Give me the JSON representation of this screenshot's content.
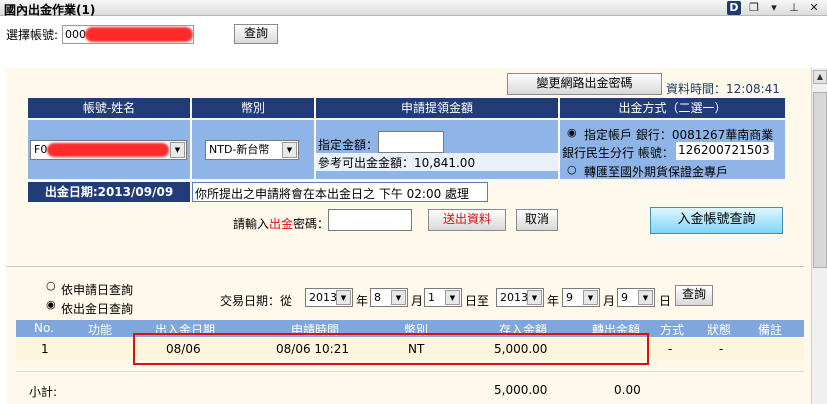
{
  "window": {
    "title": "國內出金作業(1)"
  },
  "account_select": {
    "label": "選擇帳號:",
    "value_prefix": "000",
    "query_button": "查詢"
  },
  "top_actions": {
    "change_password_button": "變更網路出金密碼",
    "data_time_label": "資料時間：12:08:41"
  },
  "headers": {
    "account_name": "帳號-姓名",
    "currency": "幣別",
    "withdraw_amount": "申請提領金額",
    "method": "出金方式（二選一）"
  },
  "account_dropdown": {
    "value_prefix": "F0"
  },
  "currency_dropdown": {
    "value": "NTD-新台幣"
  },
  "amount": {
    "label": "指定金額：",
    "reference_label": "參考可出金金額：10,841.00"
  },
  "method": {
    "option1_line1": "指定帳戶 銀行：0081267華南商業",
    "option1_line2": "銀行民生分行  帳號：",
    "option1_account": "126200721503",
    "option2": "轉匯至國外期貨保證金專戶"
  },
  "withdraw_date": {
    "label": "出金日期:2013/09/09",
    "notice": "你所提出之申請將會在本出金日之 下午 02:00 處理"
  },
  "password": {
    "label_prefix": "請輸入",
    "label_red": "出金",
    "label_suffix": "密碼："
  },
  "buttons": {
    "submit": "送出資料",
    "cancel": "取消",
    "deposit_account_query": "入金帳號查詢"
  },
  "query": {
    "radio1": "依申請日查詢",
    "radio2": "依出金日查詢",
    "trade_date_label": "交易日期：從",
    "from_year": "2013",
    "year_label": "年",
    "from_month": "8",
    "month_label": "月",
    "from_day": "1",
    "day_label": "日",
    "to_label": "至",
    "to_year": "2013",
    "to_month": "9",
    "to_day": "9",
    "query_button": "查詢"
  },
  "table": {
    "columns": [
      "No.",
      "功能",
      "出入金日期",
      "申請時間",
      "幣別",
      "存入金額",
      "轉出金額",
      "方式",
      "狀態",
      "備註"
    ],
    "rows": [
      {
        "no": "1",
        "func": "",
        "date": "08/06",
        "time": "08/06 10:21",
        "currency": "NT",
        "deposit": "5,000.00",
        "withdraw": "",
        "method": "-",
        "status": "-",
        "note": ""
      }
    ],
    "subtotal_label": "小計:",
    "subtotal_deposit": "5,000.00",
    "subtotal_withdraw": "0.00"
  }
}
